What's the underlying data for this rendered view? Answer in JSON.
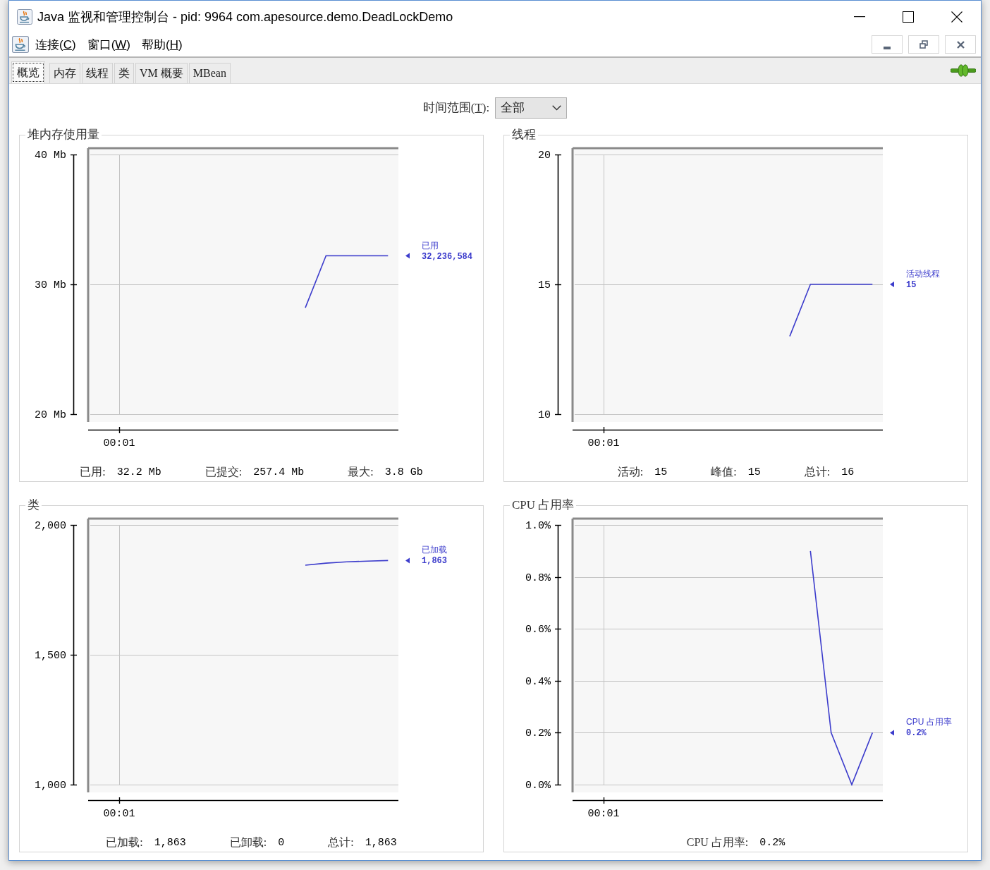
{
  "window": {
    "title": "Java 监视和管理控制台 - pid: 9964 com.apesource.demo.DeadLockDemo"
  },
  "menu": [
    {
      "label": "连接(",
      "mnemonic": "C",
      "tail": ")"
    },
    {
      "label": "窗口(",
      "mnemonic": "W",
      "tail": ")"
    },
    {
      "label": "帮助(",
      "mnemonic": "H",
      "tail": ")"
    }
  ],
  "tabs": [
    {
      "label": "概览",
      "selected": true
    },
    {
      "label": "内存",
      "selected": false
    },
    {
      "label": "线程",
      "selected": false
    },
    {
      "label": "类",
      "selected": false
    },
    {
      "label": "VM 概要",
      "selected": false
    },
    {
      "label": "MBean",
      "selected": false
    }
  ],
  "time_range": {
    "label": "时间范围(",
    "mnemonic": "T",
    "tail": "):",
    "value": "全部"
  },
  "panels": [
    {
      "legend_value": "32,236,584",
      "stats": [
        {
          "label": "已用:",
          "value": "32.2 Mb"
        },
        {
          "label": "已提交:",
          "value": "257.4 Mb"
        },
        {
          "label": "最大:",
          "value": "3.8 Gb"
        }
      ],
      "chart_data": {
        "type": "line",
        "title": "堆内存使用量",
        "categories": [
          null,
          "00:01",
          null,
          null,
          null,
          null,
          null,
          null,
          null,
          null,
          null,
          null,
          null,
          null,
          null
        ],
        "series": [
          {
            "name": "已用",
            "color": "#3c3ccc",
            "values": [
              null,
              null,
              null,
              null,
              null,
              null,
              null,
              null,
              null,
              null,
              28.2,
              32.2,
              32.2,
              32.2,
              32.2
            ]
          }
        ],
        "ylim": [
          20,
          40
        ],
        "yticks": [
          {
            "value": 20,
            "label": "20 Mb"
          },
          {
            "value": 30,
            "label": "30 Mb"
          },
          {
            "value": 40,
            "label": "40 Mb"
          }
        ],
        "grid": true
      }
    },
    {
      "legend_value": "15",
      "stats": [
        {
          "label": "活动:",
          "value": "15"
        },
        {
          "label": "峰值:",
          "value": "15"
        },
        {
          "label": "总计:",
          "value": "16"
        }
      ],
      "chart_data": {
        "type": "line",
        "title": "线程",
        "categories": [
          null,
          "00:01",
          null,
          null,
          null,
          null,
          null,
          null,
          null,
          null,
          null,
          null,
          null,
          null,
          null
        ],
        "series": [
          {
            "name": "活动线程",
            "color": "#3c3ccc",
            "values": [
              null,
              null,
              null,
              null,
              null,
              null,
              null,
              null,
              null,
              null,
              13,
              15,
              15,
              15,
              15
            ]
          }
        ],
        "ylim": [
          10,
          20
        ],
        "yticks": [
          {
            "value": 10,
            "label": "10"
          },
          {
            "value": 15,
            "label": "15"
          },
          {
            "value": 20,
            "label": "20"
          }
        ],
        "grid": true
      }
    },
    {
      "legend_value": "1,863",
      "stats": [
        {
          "label": "已加载:",
          "value": "1,863"
        },
        {
          "label": "已卸载:",
          "value": "0"
        },
        {
          "label": "总计:",
          "value": "1,863"
        }
      ],
      "chart_data": {
        "type": "line",
        "title": "类",
        "categories": [
          null,
          "00:01",
          null,
          null,
          null,
          null,
          null,
          null,
          null,
          null,
          null,
          null,
          null,
          null,
          null
        ],
        "series": [
          {
            "name": "已加载",
            "color": "#3c3ccc",
            "values": [
              null,
              null,
              null,
              null,
              null,
              null,
              null,
              null,
              null,
              null,
              1845,
              1853,
              1858,
              1861,
              1863
            ]
          }
        ],
        "ylim": [
          1000,
          2000
        ],
        "yticks": [
          {
            "value": 1000,
            "label": "1,000"
          },
          {
            "value": 1500,
            "label": "1,500"
          },
          {
            "value": 2000,
            "label": "2,000"
          }
        ],
        "grid": true
      }
    },
    {
      "legend_value": "0.2%",
      "stats": [
        {
          "label": "CPU 占用率:",
          "value": "0.2%"
        }
      ],
      "chart_data": {
        "type": "line",
        "title": "CPU 占用率",
        "categories": [
          null,
          "00:01",
          null,
          null,
          null,
          null,
          null,
          null,
          null,
          null,
          null,
          null,
          null,
          null,
          null
        ],
        "series": [
          {
            "name": "CPU 占用率",
            "color": "#3c3ccc",
            "values": [
              null,
              null,
              null,
              null,
              null,
              null,
              null,
              null,
              null,
              null,
              null,
              0.9,
              0.2,
              0.0,
              0.2
            ]
          }
        ],
        "ylim": [
          0,
          1.0
        ],
        "yticks": [
          {
            "value": 0,
            "label": "0.0%"
          },
          {
            "value": 0.2,
            "label": "0.2%"
          },
          {
            "value": 0.4,
            "label": "0.4%"
          },
          {
            "value": 0.6,
            "label": "0.6%"
          },
          {
            "value": 0.8,
            "label": "0.8%"
          },
          {
            "value": 1.0,
            "label": "1.0%"
          }
        ],
        "grid": true
      }
    }
  ]
}
